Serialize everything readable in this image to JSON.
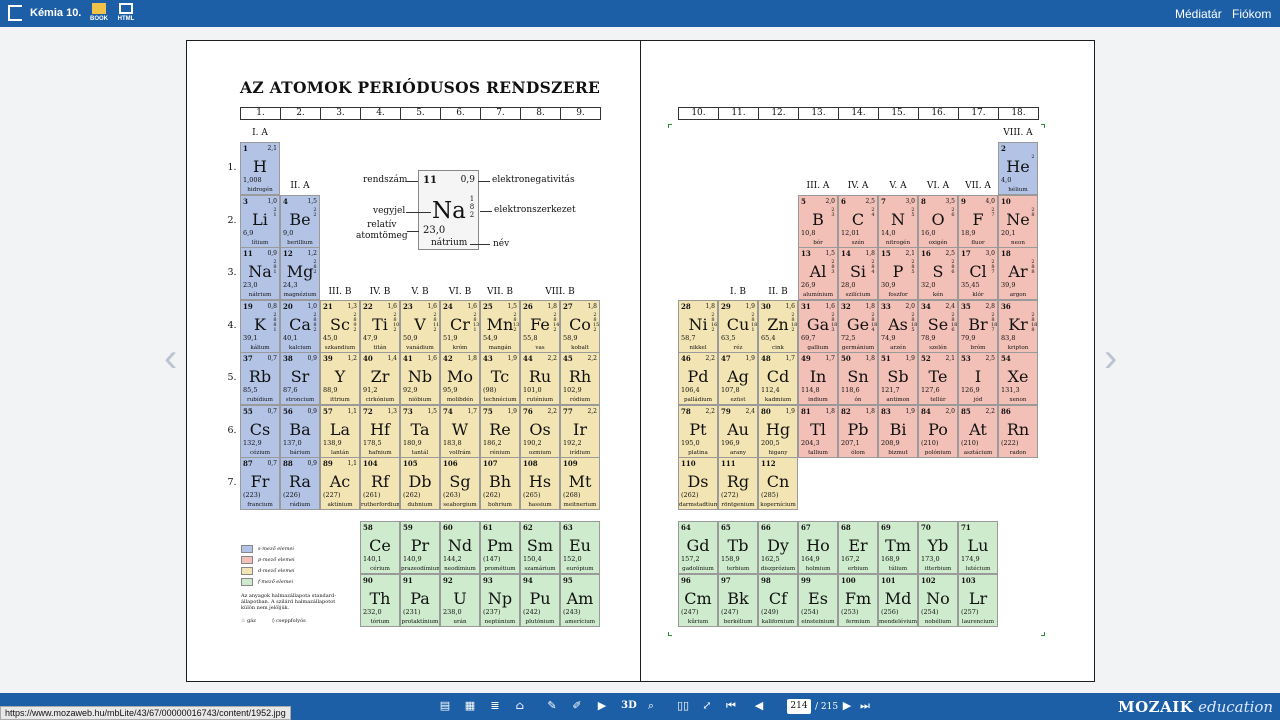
{
  "app": {
    "title": "Kémia 10.",
    "book_label": "BOOK",
    "html_label": "HTML",
    "media_label": "Médiatár",
    "account_label": "Fiókom"
  },
  "heading": "AZ ATOMOK PERIÓDUSOS RENDSZERE",
  "groups_left": [
    "1.",
    "2.",
    "3.",
    "4.",
    "5.",
    "6.",
    "7.",
    "8.",
    "9."
  ],
  "groups_right": [
    "10.",
    "11.",
    "12.",
    "13.",
    "14.",
    "15.",
    "16.",
    "17.",
    "18."
  ],
  "subgroups": [
    "I. A",
    "II. A",
    "III. B",
    "IV. B",
    "V. B",
    "VI. B",
    "VII. B",
    "VIII. B",
    "I. B",
    "II. B",
    "III. A",
    "IV. A",
    "V. A",
    "VI. A",
    "VII. A",
    "VIII. A"
  ],
  "periods": [
    "1.",
    "2.",
    "3.",
    "4.",
    "5.",
    "6.",
    "7."
  ],
  "example": {
    "z": "11",
    "en": "0,9",
    "sym": "Na",
    "shells": [
      "1",
      "8",
      "2"
    ],
    "mass": "23,0",
    "name": "nátrium",
    "lbl_z": "rendszám",
    "lbl_sym": "vegyjel",
    "lbl_mass": "relatív\natomtömeg",
    "lbl_en": "elektronegativitás",
    "lbl_shell": "elektronszerkezet",
    "lbl_name": "név"
  },
  "elements": [
    [
      "1",
      "2,1",
      "H",
      "1,008",
      "hidrogén",
      "s",
      0,
      0,
      ""
    ],
    [
      "2",
      "",
      "He",
      "4,0",
      "hélium",
      "s",
      17,
      0,
      "2"
    ],
    [
      "3",
      "1,0",
      "Li",
      "6,9",
      "lítium",
      "s",
      0,
      1,
      "2 1"
    ],
    [
      "4",
      "1,5",
      "Be",
      "9,0",
      "berillium",
      "s",
      1,
      1,
      "2 2"
    ],
    [
      "5",
      "2,0",
      "B",
      "10,8",
      "bór",
      "p",
      12,
      1,
      "2 3"
    ],
    [
      "6",
      "2,5",
      "C",
      "12,01",
      "szén",
      "p",
      13,
      1,
      "2 4"
    ],
    [
      "7",
      "3,0",
      "N",
      "14,0",
      "nitrogén",
      "p",
      14,
      1,
      "2 5"
    ],
    [
      "8",
      "3,5",
      "O",
      "16,0",
      "oxigén",
      "p",
      15,
      1,
      "2 6"
    ],
    [
      "9",
      "4,0",
      "F",
      "18,9",
      "fluor",
      "p",
      16,
      1,
      "2 7"
    ],
    [
      "10",
      "",
      "Ne",
      "20,1",
      "neon",
      "p",
      17,
      1,
      "2 8"
    ],
    [
      "11",
      "0,9",
      "Na",
      "23,0",
      "nátrium",
      "s",
      0,
      2,
      "2 8 1"
    ],
    [
      "12",
      "1,2",
      "Mg",
      "24,3",
      "magnézium",
      "s",
      1,
      2,
      "2 8 2"
    ],
    [
      "13",
      "1,5",
      "Al",
      "26,9",
      "alumínium",
      "p",
      12,
      2,
      "2 8 3"
    ],
    [
      "14",
      "1,8",
      "Si",
      "28,0",
      "szilícium",
      "p",
      13,
      2,
      "2 8 4"
    ],
    [
      "15",
      "2,1",
      "P",
      "30,9",
      "foszfor",
      "p",
      14,
      2,
      "2 8 5"
    ],
    [
      "16",
      "2,5",
      "S",
      "32,0",
      "kén",
      "p",
      15,
      2,
      "2 8 6"
    ],
    [
      "17",
      "3,0",
      "Cl",
      "35,45",
      "klór",
      "p",
      16,
      2,
      "2 8 7"
    ],
    [
      "18",
      "",
      "Ar",
      "39,9",
      "argon",
      "p",
      17,
      2,
      "2 8 8"
    ],
    [
      "19",
      "0,8",
      "K",
      "39,1",
      "kálium",
      "s",
      0,
      3,
      "2 8 8 1"
    ],
    [
      "20",
      "1,0",
      "Ca",
      "40,1",
      "kalcium",
      "s",
      1,
      3,
      "2 8 8 2"
    ],
    [
      "21",
      "1,3",
      "Sc",
      "45,0",
      "szkandium",
      "d",
      2,
      3,
      "2 8 9 2"
    ],
    [
      "22",
      "1,6",
      "Ti",
      "47,9",
      "titán",
      "d",
      3,
      3,
      "2 8 10 2"
    ],
    [
      "23",
      "1,6",
      "V",
      "50,9",
      "vanádium",
      "d",
      4,
      3,
      "2 8 11 2"
    ],
    [
      "24",
      "1,6",
      "Cr",
      "51,9",
      "króm",
      "d",
      5,
      3,
      "2 8 13 1"
    ],
    [
      "25",
      "1,5",
      "Mn",
      "54,9",
      "mangán",
      "d",
      6,
      3,
      "2 8 13 2"
    ],
    [
      "26",
      "1,8",
      "Fe",
      "55,8",
      "vas",
      "d",
      7,
      3,
      "2 8 14 2"
    ],
    [
      "27",
      "1,8",
      "Co",
      "58,9",
      "kobalt",
      "d",
      8,
      3,
      "2 8 15 2"
    ],
    [
      "28",
      "1,8",
      "Ni",
      "58,7",
      "nikkel",
      "d",
      9,
      3,
      "2 8 16 2"
    ],
    [
      "29",
      "1,9",
      "Cu",
      "63,5",
      "réz",
      "d",
      10,
      3,
      "2 8 18 1"
    ],
    [
      "30",
      "1,6",
      "Zn",
      "65,4",
      "cink",
      "d",
      11,
      3,
      "2 8 18 2"
    ],
    [
      "31",
      "1,6",
      "Ga",
      "69,7",
      "gallium",
      "p",
      12,
      3,
      "2 8 18 3"
    ],
    [
      "32",
      "1,8",
      "Ge",
      "72,5",
      "germánium",
      "p",
      13,
      3,
      "2 8 18 4"
    ],
    [
      "33",
      "2,0",
      "As",
      "74,9",
      "arzén",
      "p",
      14,
      3,
      "2 8 18 5"
    ],
    [
      "34",
      "2,4",
      "Se",
      "78,9",
      "szelén",
      "p",
      15,
      3,
      "2 8 18 6"
    ],
    [
      "35",
      "2,8",
      "Br",
      "79,9",
      "bróm",
      "p",
      16,
      3,
      "2 8 18 7"
    ],
    [
      "36",
      "",
      "Kr",
      "83,8",
      "kripton",
      "p",
      17,
      3,
      "2 8 18 8"
    ],
    [
      "37",
      "0,7",
      "Rb",
      "85,5",
      "rubídium",
      "s",
      0,
      4,
      ""
    ],
    [
      "38",
      "0,9",
      "Sr",
      "87,6",
      "stroncium",
      "s",
      1,
      4,
      ""
    ],
    [
      "39",
      "1,2",
      "Y",
      "88,9",
      "ittrium",
      "d",
      2,
      4,
      ""
    ],
    [
      "40",
      "1,4",
      "Zr",
      "91,2",
      "cirkónium",
      "d",
      3,
      4,
      ""
    ],
    [
      "41",
      "1,6",
      "Nb",
      "92,9",
      "nióbium",
      "d",
      4,
      4,
      ""
    ],
    [
      "42",
      "1,8",
      "Mo",
      "95,9",
      "molibdén",
      "d",
      5,
      4,
      ""
    ],
    [
      "43",
      "1,9",
      "Tc",
      "(98)",
      "technécium",
      "d",
      6,
      4,
      ""
    ],
    [
      "44",
      "2,2",
      "Ru",
      "101,0",
      "ruténium",
      "d",
      7,
      4,
      ""
    ],
    [
      "45",
      "2,2",
      "Rh",
      "102,9",
      "ródium",
      "d",
      8,
      4,
      ""
    ],
    [
      "46",
      "2,2",
      "Pd",
      "106,4",
      "palládium",
      "d",
      9,
      4,
      ""
    ],
    [
      "47",
      "1,9",
      "Ag",
      "107,8",
      "ezüst",
      "d",
      10,
      4,
      ""
    ],
    [
      "48",
      "1,7",
      "Cd",
      "112,4",
      "kadmium",
      "d",
      11,
      4,
      ""
    ],
    [
      "49",
      "1,7",
      "In",
      "114,8",
      "indium",
      "p",
      12,
      4,
      ""
    ],
    [
      "50",
      "1,8",
      "Sn",
      "118,6",
      "ón",
      "p",
      13,
      4,
      ""
    ],
    [
      "51",
      "1,9",
      "Sb",
      "121,7",
      "antimon",
      "p",
      14,
      4,
      ""
    ],
    [
      "52",
      "2,1",
      "Te",
      "127,6",
      "tellúr",
      "p",
      15,
      4,
      ""
    ],
    [
      "53",
      "2,5",
      "I",
      "126,9",
      "jód",
      "p",
      16,
      4,
      ""
    ],
    [
      "54",
      "",
      "Xe",
      "131,3",
      "xenon",
      "p",
      17,
      4,
      ""
    ],
    [
      "55",
      "0,7",
      "Cs",
      "132,9",
      "cézium",
      "s",
      0,
      5,
      ""
    ],
    [
      "56",
      "0,9",
      "Ba",
      "137,0",
      "bárium",
      "s",
      1,
      5,
      ""
    ],
    [
      "57",
      "1,1",
      "La",
      "138,9",
      "lantán",
      "d",
      2,
      5,
      ""
    ],
    [
      "72",
      "1,3",
      "Hf",
      "178,5",
      "hafnium",
      "d",
      3,
      5,
      ""
    ],
    [
      "73",
      "1,5",
      "Ta",
      "180,9",
      "tantál",
      "d",
      4,
      5,
      ""
    ],
    [
      "74",
      "1,7",
      "W",
      "183,8",
      "volfrám",
      "d",
      5,
      5,
      ""
    ],
    [
      "75",
      "1,9",
      "Re",
      "186,2",
      "rénium",
      "d",
      6,
      5,
      ""
    ],
    [
      "76",
      "2,2",
      "Os",
      "190,2",
      "ozmium",
      "d",
      7,
      5,
      ""
    ],
    [
      "77",
      "2,2",
      "Ir",
      "192,2",
      "irídium",
      "d",
      8,
      5,
      ""
    ],
    [
      "78",
      "2,2",
      "Pt",
      "195,0",
      "platina",
      "d",
      9,
      5,
      ""
    ],
    [
      "79",
      "2,4",
      "Au",
      "196,9",
      "arany",
      "d",
      10,
      5,
      ""
    ],
    [
      "80",
      "1,9",
      "Hg",
      "200,5",
      "higany",
      "d",
      11,
      5,
      ""
    ],
    [
      "81",
      "1,8",
      "Tl",
      "204,3",
      "tallium",
      "p",
      12,
      5,
      ""
    ],
    [
      "82",
      "1,8",
      "Pb",
      "207,1",
      "ólom",
      "p",
      13,
      5,
      ""
    ],
    [
      "83",
      "1,9",
      "Bi",
      "208,9",
      "bizmut",
      "p",
      14,
      5,
      ""
    ],
    [
      "84",
      "2,0",
      "Po",
      "(210)",
      "polónium",
      "p",
      15,
      5,
      ""
    ],
    [
      "85",
      "2,2",
      "At",
      "(210)",
      "asztácium",
      "p",
      16,
      5,
      ""
    ],
    [
      "86",
      "",
      "Rn",
      "(222)",
      "radon",
      "p",
      17,
      5,
      ""
    ],
    [
      "87",
      "0,7",
      "Fr",
      "(223)",
      "francium",
      "s",
      0,
      6,
      ""
    ],
    [
      "88",
      "0,9",
      "Ra",
      "(226)",
      "rádium",
      "s",
      1,
      6,
      ""
    ],
    [
      "89",
      "1,1",
      "Ac",
      "(227)",
      "aktínium",
      "d",
      2,
      6,
      ""
    ],
    [
      "104",
      "",
      "Rf",
      "(261)",
      "rutherfordium",
      "d",
      3,
      6,
      ""
    ],
    [
      "105",
      "",
      "Db",
      "(262)",
      "dubnium",
      "d",
      4,
      6,
      ""
    ],
    [
      "106",
      "",
      "Sg",
      "(263)",
      "seaborgium",
      "d",
      5,
      6,
      ""
    ],
    [
      "107",
      "",
      "Bh",
      "(262)",
      "bohrium",
      "d",
      6,
      6,
      ""
    ],
    [
      "108",
      "",
      "Hs",
      "(265)",
      "hassium",
      "d",
      7,
      6,
      ""
    ],
    [
      "109",
      "",
      "Mt",
      "(268)",
      "meitnerium",
      "d",
      8,
      6,
      ""
    ],
    [
      "110",
      "",
      "Ds",
      "(262)",
      "darmstadtium",
      "d",
      9,
      6,
      ""
    ],
    [
      "111",
      "",
      "Rg",
      "(272)",
      "röntgenium",
      "d",
      10,
      6,
      ""
    ],
    [
      "112",
      "",
      "Cn",
      "(285)",
      "kopernícium",
      "d",
      11,
      6,
      ""
    ],
    [
      "58",
      "",
      "Ce",
      "140,1",
      "cérium",
      "f",
      3,
      7,
      ""
    ],
    [
      "59",
      "",
      "Pr",
      "140,9",
      "prazeodímium",
      "f",
      4,
      7,
      ""
    ],
    [
      "60",
      "",
      "Nd",
      "144,2",
      "neodímium",
      "f",
      5,
      7,
      ""
    ],
    [
      "61",
      "",
      "Pm",
      "(147)",
      "prométium",
      "f",
      6,
      7,
      ""
    ],
    [
      "62",
      "",
      "Sm",
      "150,4",
      "szamárium",
      "f",
      7,
      7,
      ""
    ],
    [
      "63",
      "",
      "Eu",
      "152,0",
      "európium",
      "f",
      8,
      7,
      ""
    ],
    [
      "64",
      "",
      "Gd",
      "157,2",
      "gadolínium",
      "f",
      9,
      7,
      ""
    ],
    [
      "65",
      "",
      "Tb",
      "158,9",
      "terbium",
      "f",
      10,
      7,
      ""
    ],
    [
      "66",
      "",
      "Dy",
      "162,5",
      "diszprózium",
      "f",
      11,
      7,
      ""
    ],
    [
      "67",
      "",
      "Ho",
      "164,9",
      "holmium",
      "f",
      12,
      7,
      ""
    ],
    [
      "68",
      "",
      "Er",
      "167,2",
      "erbium",
      "f",
      13,
      7,
      ""
    ],
    [
      "69",
      "",
      "Tm",
      "168,9",
      "túlium",
      "f",
      14,
      7,
      ""
    ],
    [
      "70",
      "",
      "Yb",
      "173,0",
      "itterbium",
      "f",
      15,
      7,
      ""
    ],
    [
      "71",
      "",
      "Lu",
      "174,9",
      "lutécium",
      "f",
      16,
      7,
      ""
    ],
    [
      "90",
      "",
      "Th",
      "232,0",
      "tórium",
      "f",
      3,
      8,
      ""
    ],
    [
      "91",
      "",
      "Pa",
      "(231)",
      "protaktínium",
      "f",
      4,
      8,
      ""
    ],
    [
      "92",
      "",
      "U",
      "238,0",
      "urán",
      "f",
      5,
      8,
      ""
    ],
    [
      "93",
      "",
      "Np",
      "(237)",
      "neptúnium",
      "f",
      6,
      8,
      ""
    ],
    [
      "94",
      "",
      "Pu",
      "(242)",
      "plutónium",
      "f",
      7,
      8,
      ""
    ],
    [
      "95",
      "",
      "Am",
      "(243)",
      "amerícium",
      "f",
      8,
      8,
      ""
    ],
    [
      "96",
      "",
      "Cm",
      "(247)",
      "kűrium",
      "f",
      9,
      8,
      ""
    ],
    [
      "97",
      "",
      "Bk",
      "(247)",
      "berkélium",
      "f",
      10,
      8,
      ""
    ],
    [
      "98",
      "",
      "Cf",
      "(249)",
      "kalifornium",
      "f",
      11,
      8,
      ""
    ],
    [
      "99",
      "",
      "Es",
      "(254)",
      "einsteinium",
      "f",
      12,
      8,
      ""
    ],
    [
      "100",
      "",
      "Fm",
      "(253)",
      "fermium",
      "f",
      13,
      8,
      ""
    ],
    [
      "101",
      "",
      "Md",
      "(256)",
      "mendelévium",
      "f",
      14,
      8,
      ""
    ],
    [
      "102",
      "",
      "No",
      "(254)",
      "nobélium",
      "f",
      15,
      8,
      ""
    ],
    [
      "103",
      "",
      "Lr",
      "(257)",
      "laurencium",
      "f",
      16,
      8,
      ""
    ]
  ],
  "legend": {
    "items": [
      "s-mező elemei",
      "p-mező elemei",
      "d-mező elemei",
      "f-mező elemei"
    ],
    "note": "Az anyagok halmazállapota standard-állapotban. A szilárd halmazállapotot külön nem jelöljük.",
    "gas": "gáz",
    "liquid": "cseppfolyós"
  },
  "colors": {
    "s": "#b3c3e6",
    "p": "#f3c0b7",
    "d": "#f3e5b3",
    "f": "#cfebcd",
    "bar": "#1d5fa6"
  },
  "toolbar": {
    "page": "214",
    "total": "/ 215",
    "url": "https://www.mozaweb.hu/mbLite/43/67/00000016743/content/1952.jpg",
    "brand_a": "MOZAIK",
    "brand_b": "education",
    "icons": [
      "notes-icon",
      "grid-icon",
      "layers-icon",
      "library-icon",
      "tools-icon",
      "pen-icon",
      "play-icon",
      "3d-icon",
      "zoom-icon",
      "double-page-icon",
      "fit-icon",
      "first-page-icon",
      "prev-page-icon",
      "next-page-icon",
      "last-page-icon"
    ],
    "label_3d": "3D"
  }
}
